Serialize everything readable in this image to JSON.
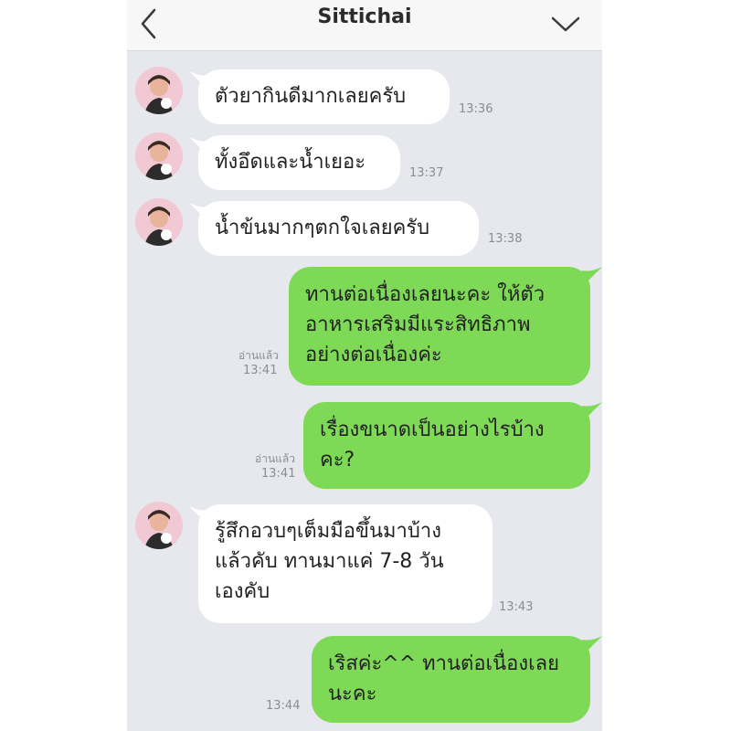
{
  "header": {
    "title": "Sittichai",
    "back_icon": "chevron-left-icon",
    "menu_icon": "chevron-down-icon"
  },
  "colors": {
    "incoming_bubble": "#ffffff",
    "outgoing_bubble": "#7ed957",
    "chat_background": "#e6e8ed"
  },
  "messages": [
    {
      "direction": "in",
      "lines": [
        "ตัวยากินดีมากเลยครับ"
      ],
      "time": "13:36"
    },
    {
      "direction": "in",
      "lines": [
        "ทั้งอึดและน้ำเยอะ"
      ],
      "time": "13:37"
    },
    {
      "direction": "in",
      "lines": [
        "น้ำข้นมากๆตกใจเลยครับ"
      ],
      "time": "13:38"
    },
    {
      "direction": "out",
      "lines": [
        "ทานต่อเนื่องเลยนะคะ ให้ตัว",
        "อาหารเสริมมีแระสิทธิภาพ",
        "อย่างต่อเนื่องค่ะ"
      ],
      "read": "อ่านแล้ว",
      "time": "13:41"
    },
    {
      "direction": "out",
      "lines": [
        "เรื่องขนาดเป็นอย่างไรบ้าง",
        "คะ?"
      ],
      "read": "อ่านแล้ว",
      "time": "13:41"
    },
    {
      "direction": "in",
      "lines": [
        "รู้สึกอวบๆเต็มมือขึ้นมาบ้าง",
        "แล้วคับ ทานมาแค่ 7-8 วัน",
        "เองคับ"
      ],
      "time": "13:43"
    },
    {
      "direction": "out",
      "lines": [
        "เริสค่ะ^^ ทานต่อเนื่องเลย",
        "นะคะ"
      ],
      "time": "13:44"
    }
  ]
}
